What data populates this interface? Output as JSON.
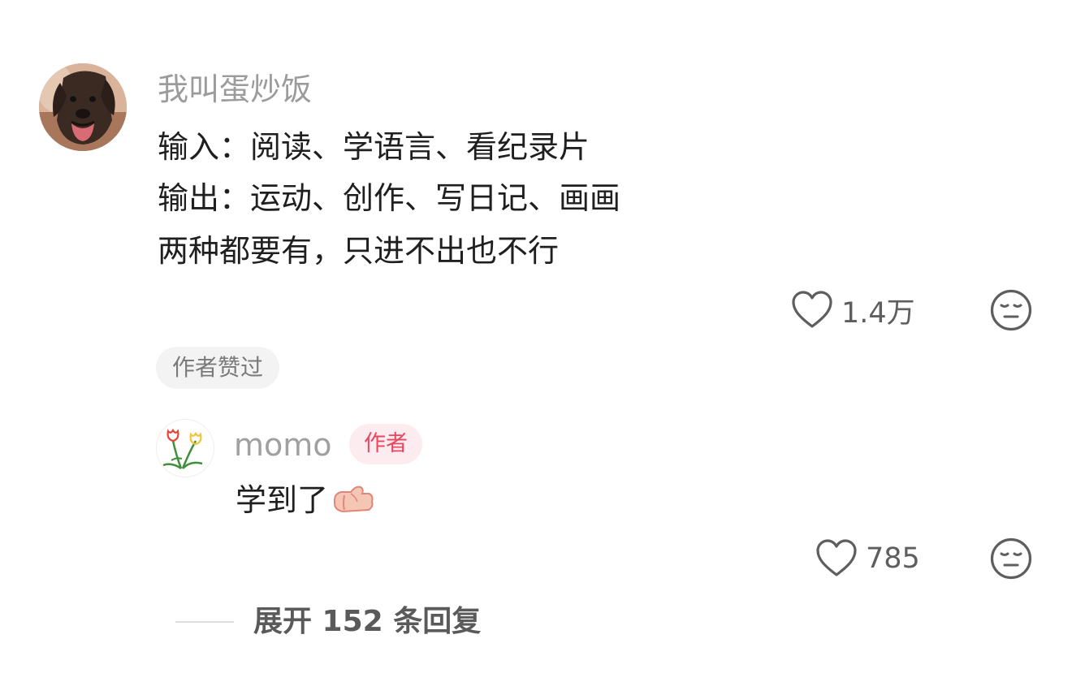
{
  "comment": {
    "username": "我叫蛋炒饭",
    "lines": [
      "输入：阅读、学语言、看纪录片",
      "输出：运动、创作、写日记、画画",
      "两种都要有，只进不出也不行"
    ],
    "likes": "1.4万",
    "author_liked_label": "作者赞过"
  },
  "reply": {
    "username": "momo",
    "author_badge": "作者",
    "text": "学到了",
    "likes": "785"
  },
  "expand": {
    "label": "展开 152 条回复"
  },
  "icons": {
    "like": "heart-outline-icon",
    "dislike": "neutral-face-icon",
    "emoji": "thumbs-up-emoji-icon"
  },
  "colors": {
    "text_primary": "#1f1f1f",
    "text_secondary": "#9b9b9b",
    "badge_bg": "#fdecef",
    "badge_text": "#e8475f"
  }
}
